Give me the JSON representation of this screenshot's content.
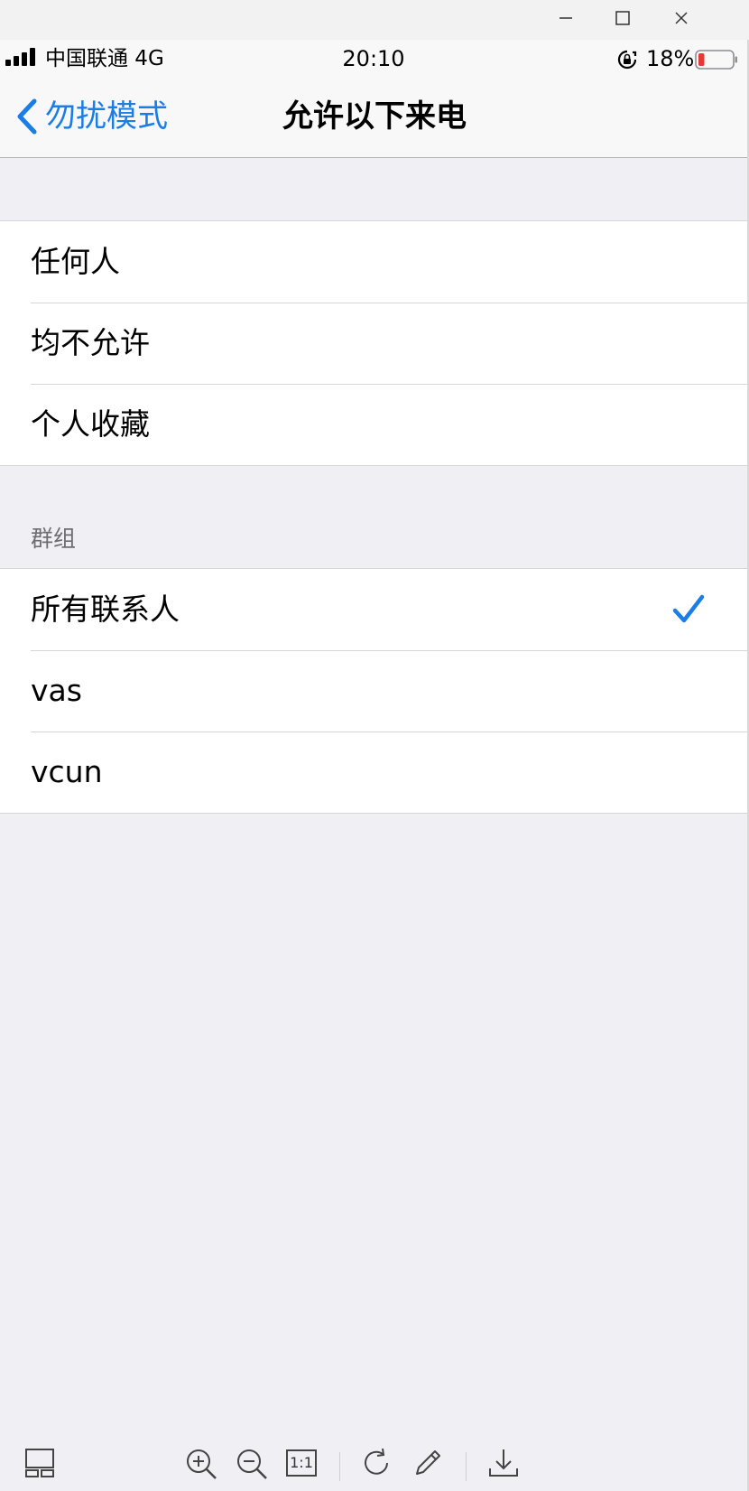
{
  "window": {
    "controls": [
      "minimize-icon",
      "maximize-icon",
      "close-icon"
    ]
  },
  "status_bar": {
    "carrier": "中国联通 4G",
    "time": "20:10",
    "battery_percent": "18%",
    "battery_level": 0.18,
    "battery_color": "#e53935"
  },
  "nav": {
    "back_label": "勿扰模式",
    "title": "允许以下来电",
    "accent": "#1a7ee6"
  },
  "sections": [
    {
      "items": [
        {
          "label": "任何人",
          "checked": false
        },
        {
          "label": "均不允许",
          "checked": false
        },
        {
          "label": "个人收藏",
          "checked": false
        }
      ]
    },
    {
      "header": "群组",
      "items": [
        {
          "label": "所有联系人",
          "checked": true
        },
        {
          "label": "vas",
          "checked": false
        },
        {
          "label": "vcun",
          "checked": false
        }
      ]
    }
  ],
  "toolbar": {
    "ratio_label": "1:1",
    "tools": [
      "thumbnails-icon",
      "zoom-in-icon",
      "zoom-out-icon",
      "actual-size-icon",
      "rotate-icon",
      "edit-icon",
      "download-icon"
    ]
  }
}
